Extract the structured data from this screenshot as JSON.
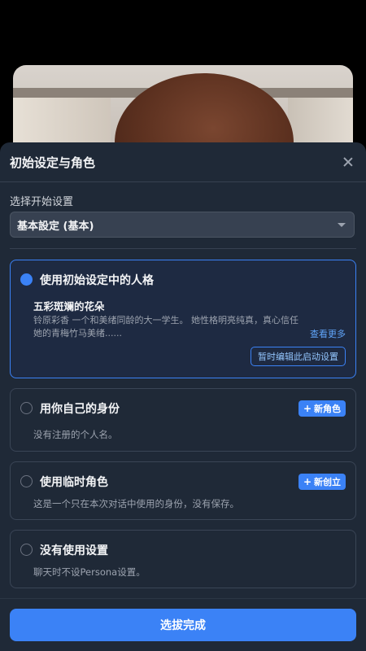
{
  "sheet": {
    "title": "初始设定与角色",
    "close_icon": "close-icon"
  },
  "start_settings": {
    "label": "选择开始设置",
    "selected": "基本設定 (基本)"
  },
  "options": {
    "initial_persona": {
      "title": "使用初始设定中的人格",
      "persona_name": "五彩斑斓的花朵",
      "persona_desc": "铃原彩香 一个和美绪同龄的大一学生。 她性格明亮纯真，真心信任她的青梅竹马美绪......",
      "see_more": "查看更多",
      "edit_button": "暂时编辑此启动设置",
      "selected": true
    },
    "own_identity": {
      "title": "用你自己的身份",
      "button": "新角色",
      "desc": "没有注册的个人名。"
    },
    "temp_role": {
      "title": "使用临时角色",
      "button": "新创立",
      "desc": "这是一个只在本次对话中使用的身份，没有保存。"
    },
    "no_setting": {
      "title": "没有使用设置",
      "desc": "聊天时不设Persona设置。"
    }
  },
  "footer": {
    "done_button": "选拔完成"
  },
  "colors": {
    "accent": "#3b82f6",
    "sheet_bg": "#1f2937"
  }
}
